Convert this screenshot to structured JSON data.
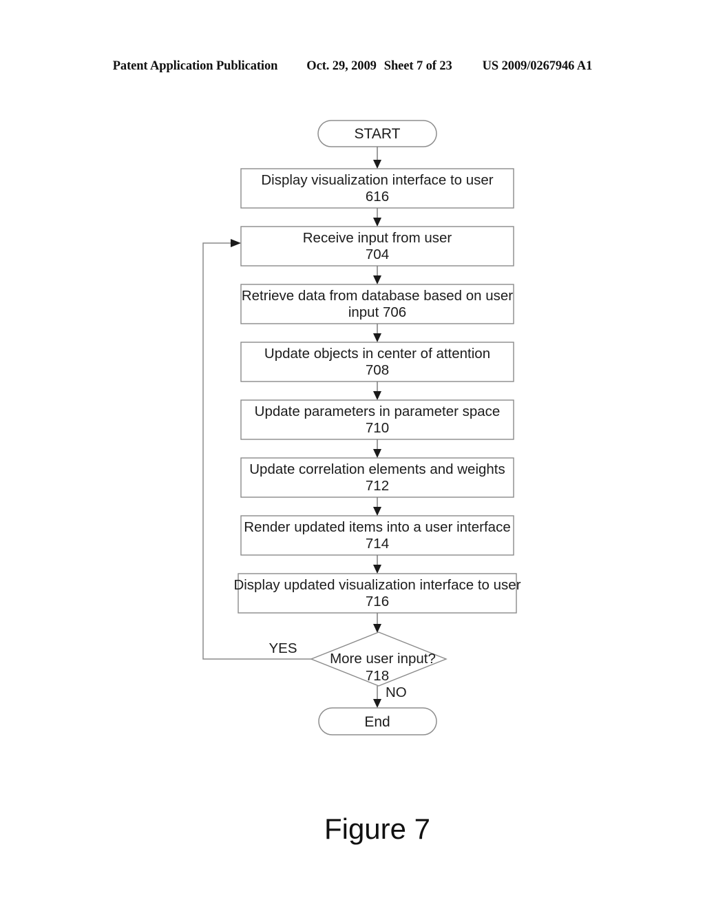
{
  "header": {
    "publication": "Patent Application Publication",
    "date": "Oct. 29, 2009",
    "sheet": "Sheet 7 of 23",
    "document_number": "US 2009/0267946 A1"
  },
  "figure": {
    "caption": "Figure 7",
    "start_label": "START",
    "end_label": "End",
    "decision": {
      "text": "More user input?",
      "reference": "718",
      "yes_label": "YES",
      "no_label": "NO"
    },
    "steps": [
      {
        "text": "Display visualization interface to user",
        "reference": "616"
      },
      {
        "text": "Receive input from user",
        "reference": "704"
      },
      {
        "text": "Retrieve data from database based on user",
        "reference": "input  706"
      },
      {
        "text": "Update objects in center of attention",
        "reference": "708"
      },
      {
        "text": "Update parameters in parameter space",
        "reference": "710"
      },
      {
        "text": "Update correlation elements and weights",
        "reference": "712"
      },
      {
        "text": "Render updated items into a user interface",
        "reference": "714"
      },
      {
        "text": "Display updated visualization interface to user",
        "reference": "716"
      }
    ]
  },
  "colors": {
    "page_background": "#ffffff",
    "ink": "#1c1c1c",
    "line": "#8a8a8a"
  }
}
